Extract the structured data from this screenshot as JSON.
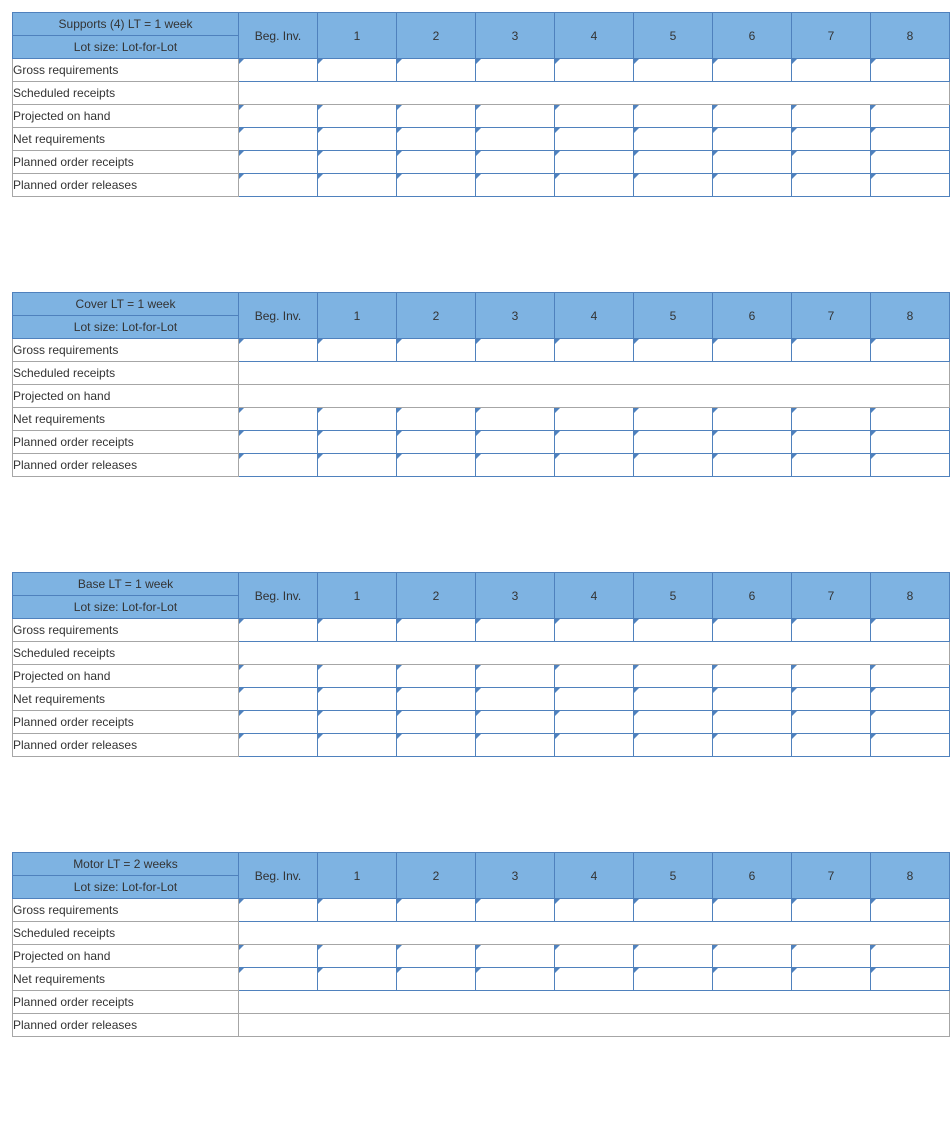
{
  "columns": {
    "beg": "Beg. Inv.",
    "1": "1",
    "2": "2",
    "3": "3",
    "4": "4",
    "5": "5",
    "6": "6",
    "7": "7",
    "8": "8"
  },
  "rows": {
    "gross": "Gross requirements",
    "sched": "Scheduled receipts",
    "proj": "Projected on hand",
    "net": "Net requirements",
    "prcpt": "Planned order receipts",
    "prel": "Planned order releases"
  },
  "lot": "Lot size: Lot-for-Lot",
  "tables": [
    {
      "title": "Supports (4) LT = 1 week",
      "row_has_markers": {
        "gross": true,
        "sched": false,
        "proj": true,
        "net": true,
        "prcpt": true,
        "prel": true
      },
      "merge_plain": [
        "sched"
      ]
    },
    {
      "title": "Cover LT = 1 week",
      "row_has_markers": {
        "gross": true,
        "sched": false,
        "proj": false,
        "net": true,
        "prcpt": true,
        "prel": true
      },
      "merge_plain": [
        "sched",
        "proj"
      ]
    },
    {
      "title": "Base LT = 1 week",
      "row_has_markers": {
        "gross": true,
        "sched": false,
        "proj": true,
        "net": true,
        "prcpt": true,
        "prel": true
      },
      "merge_plain": [
        "sched"
      ]
    },
    {
      "title": "Motor LT = 2 weeks",
      "row_has_markers": {
        "gross": true,
        "sched": false,
        "proj": true,
        "net": true,
        "prcpt": false,
        "prel": false
      },
      "merge_plain": [
        "sched",
        "prcpt",
        "prel"
      ]
    }
  ]
}
